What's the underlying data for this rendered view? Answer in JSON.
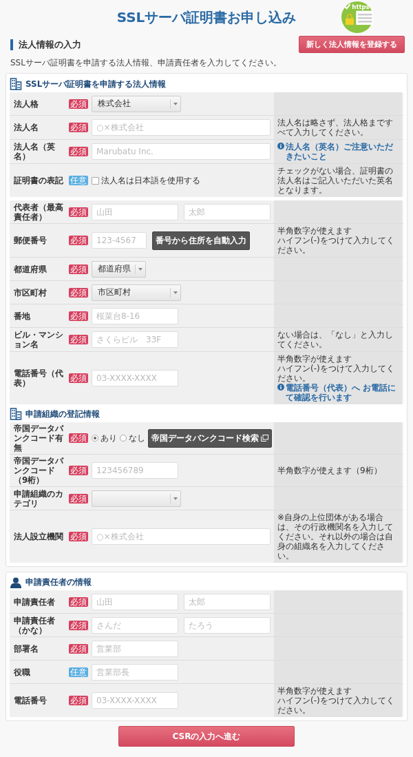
{
  "header": {
    "title": "SSLサーバ証明書お申し込み",
    "logo_text": "https"
  },
  "section": {
    "title": "法人情報の入力",
    "action_button": "新しく法人情報を登録する",
    "description": "SSLサーバ証明書を申請する法人情報、申請責任者を入力してください。"
  },
  "cards": [
    {
      "blocks": [
        {
          "heading": "SSLサーバ証明書を申請する法人情報",
          "rows": [
            {
              "label": "法人格",
              "badge": {
                "text": "必須",
                "kind": "required"
              },
              "controls": [
                {
                  "kind": "select",
                  "value": "株式会社"
                }
              ]
            },
            {
              "label": "法人名",
              "badge": {
                "text": "必須",
                "kind": "required"
              },
              "controls": [
                {
                  "kind": "wide_input",
                  "placeholder": "○×株式会社"
                }
              ],
              "note": [
                {
                  "kind": "text",
                  "text": "法人名は略さず、法人格まですべて入力してください。"
                }
              ]
            },
            {
              "label": "法人名",
              "label_note": "（英名）",
              "badge": {
                "text": "必須",
                "kind": "required"
              },
              "controls": [
                {
                  "kind": "wide_input",
                  "placeholder": "Marubatu Inc."
                }
              ],
              "note": [
                {
                  "kind": "link",
                  "text": "法人名（英名）ご注意いただきたいこと"
                }
              ]
            },
            {
              "label": "証明書の表記",
              "badge": {
                "text": "任意",
                "kind": "optional"
              },
              "controls": [
                {
                  "kind": "checkbox",
                  "label": "法人名は日本語を使用する",
                  "checked": false
                }
              ],
              "note": [
                {
                  "kind": "text",
                  "text": "チェックがない場合、証明書の法人名はご記入いただいた英名となります。"
                }
              ]
            }
          ]
        },
        {
          "rows": [
            {
              "label": "代表者",
              "label_note": "（最高責任者）",
              "badge": {
                "text": "必須",
                "kind": "required"
              },
              "controls": [
                {
                  "kind": "input",
                  "placeholder": "山田"
                },
                {
                  "kind": "input",
                  "placeholder": "太郎"
                }
              ]
            },
            {
              "label": "郵便番号",
              "badge": {
                "text": "必須",
                "kind": "required"
              },
              "controls": [
                {
                  "kind": "short_input",
                  "placeholder": "123-4567"
                },
                {
                  "kind": "button",
                  "label": "番号から住所を自動入力"
                }
              ],
              "note": [
                {
                  "kind": "text",
                  "text": "半角数字が使えます"
                },
                {
                  "kind": "text",
                  "text": "ハイフン(-)をつけて入力してください。"
                }
              ]
            },
            {
              "label": "都道府県",
              "badge": {
                "text": "必須",
                "kind": "required"
              },
              "controls": [
                {
                  "kind": "short_select",
                  "value": "都道府県"
                }
              ]
            },
            {
              "label": "市区町村",
              "badge": {
                "text": "必須",
                "kind": "required"
              },
              "controls": [
                {
                  "kind": "select",
                  "value": "市区町村"
                }
              ]
            },
            {
              "label": "番地",
              "badge": {
                "text": "必須",
                "kind": "required"
              },
              "controls": [
                {
                  "kind": "input",
                  "placeholder": "桜菜台8-16"
                }
              ]
            },
            {
              "label": "ビル・マンション名",
              "badge": {
                "text": "必須",
                "kind": "required"
              },
              "controls": [
                {
                  "kind": "input",
                  "placeholder": "さくらビル　33F"
                }
              ],
              "note": [
                {
                  "kind": "text",
                  "text": "ない場合は、「なし」と入力してください。"
                }
              ]
            },
            {
              "label": "電話番号",
              "label_note": "（代表）",
              "badge": {
                "text": "必須",
                "kind": "required"
              },
              "controls": [
                {
                  "kind": "input",
                  "placeholder": "03-XXXX-XXXX"
                }
              ],
              "note": [
                {
                  "kind": "text",
                  "text": "半角数字が使えます"
                },
                {
                  "kind": "text",
                  "text": "ハイフン(-)をつけて入力してください。"
                },
                {
                  "kind": "link",
                  "text": "電話番号（代表）へ お電話にて確認を行います"
                }
              ]
            }
          ]
        },
        {
          "heading": "申請組織の登記情報",
          "rows": [
            {
              "label": "帝国データバンクコード有無",
              "badge": {
                "text": "必須",
                "kind": "required"
              },
              "controls": [
                {
                  "kind": "radio",
                  "options": [
                    {
                      "label": "あり",
                      "selected": true
                    },
                    {
                      "label": "なし",
                      "selected": false
                    }
                  ]
                },
                {
                  "kind": "lookup_button",
                  "label": "帝国データバンクコード検索"
                }
              ]
            },
            {
              "label": "帝国データバンクコード（9桁）",
              "badge": {
                "text": "必須",
                "kind": "required"
              },
              "controls": [
                {
                  "kind": "input",
                  "placeholder": "123456789"
                }
              ],
              "note": [
                {
                  "kind": "text",
                  "text": "半角数字が使えます（9桁）"
                }
              ]
            },
            {
              "label": "申請組織のカテゴリ",
              "badge": {
                "text": "必須",
                "kind": "required"
              },
              "controls": [
                {
                  "kind": "select"
                }
              ]
            },
            {
              "label": "法人設立機関",
              "badge": {
                "text": "必須",
                "kind": "required"
              },
              "controls": [
                {
                  "kind": "wide_input",
                  "placeholder": "○×株式会社"
                }
              ],
              "note": [
                {
                  "kind": "text",
                  "text": "※自身の上位団体がある場合は、その行政機関名を入力してください。それ以外の場合は自身の組織名を入力してください。"
                }
              ]
            }
          ]
        }
      ]
    },
    {
      "blocks": [
        {
          "heading": "申請責任者の情報",
          "rows": [
            {
              "label": "申請責任者",
              "badge": {
                "text": "必須",
                "kind": "required"
              },
              "controls": [
                {
                  "kind": "input",
                  "placeholder": "山田"
                },
                {
                  "kind": "input",
                  "placeholder": "太郎"
                }
              ]
            },
            {
              "label": "申請責任者",
              "label_note": "（かな）",
              "badge": {
                "text": "必須",
                "kind": "required"
              },
              "controls": [
                {
                  "kind": "input",
                  "placeholder": "さんだ"
                },
                {
                  "kind": "input",
                  "placeholder": "たろう"
                }
              ]
            },
            {
              "label": "部署名",
              "badge": {
                "text": "必須",
                "kind": "required"
              },
              "controls": [
                {
                  "kind": "input",
                  "placeholder": "営業部"
                }
              ]
            },
            {
              "label": "役職",
              "badge": {
                "text": "任意",
                "kind": "optional"
              },
              "controls": [
                {
                  "kind": "input",
                  "placeholder": "営業部長"
                }
              ]
            },
            {
              "label": "電話番号",
              "badge": {
                "text": "必須",
                "kind": "required"
              },
              "controls": [
                {
                  "kind": "input",
                  "placeholder": "03-XXXX-XXXX"
                }
              ],
              "note": [
                {
                  "kind": "text",
                  "text": "半角数字が使えます"
                },
                {
                  "kind": "text",
                  "text": "ハイフン(-)をつけて入力してください。"
                }
              ]
            }
          ]
        }
      ]
    }
  ],
  "submit_button": "CSRの入力へ進む"
}
